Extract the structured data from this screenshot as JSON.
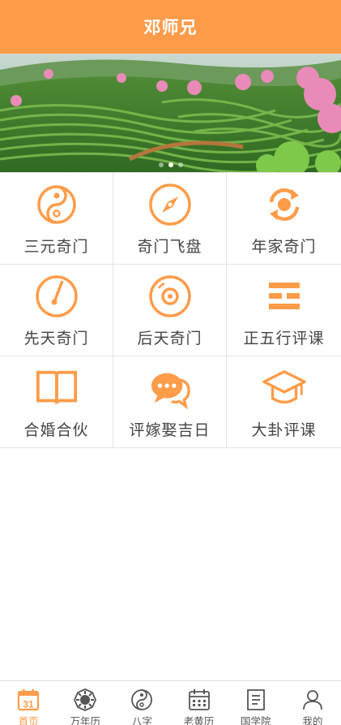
{
  "header": {
    "title": "邓师兄"
  },
  "banner": {
    "slides": 3,
    "active_slide": 1
  },
  "menu": [
    {
      "label": "三元奇门",
      "icon": "yin-yang-icon"
    },
    {
      "label": "奇门飞盘",
      "icon": "compass-icon"
    },
    {
      "label": "年家奇门",
      "icon": "cycle-arrows-icon"
    },
    {
      "label": "先天奇门",
      "icon": "dial-icon"
    },
    {
      "label": "后天奇门",
      "icon": "disc-icon"
    },
    {
      "label": "正五行评课",
      "icon": "trigram-icon"
    },
    {
      "label": "合婚合伙",
      "icon": "open-book-icon"
    },
    {
      "label": "评嫁娶吉日",
      "icon": "chat-bubbles-icon"
    },
    {
      "label": "大卦评课",
      "icon": "graduation-cap-icon"
    }
  ],
  "tabbar": {
    "items": [
      {
        "label": "首页",
        "icon": "calendar-31-icon",
        "active": true,
        "calendar_day": "31"
      },
      {
        "label": "万年历",
        "icon": "bagua-icon",
        "active": false
      },
      {
        "label": "八字",
        "icon": "yin-yang-icon",
        "active": false
      },
      {
        "label": "老黄历",
        "icon": "calendar-icon",
        "active": false
      },
      {
        "label": "国学院",
        "icon": "document-icon",
        "active": false
      },
      {
        "label": "我的",
        "icon": "user-icon",
        "active": false
      }
    ]
  },
  "colors": {
    "accent": "#ff9c4a",
    "text": "#444444",
    "divider": "#e4e4e4"
  }
}
